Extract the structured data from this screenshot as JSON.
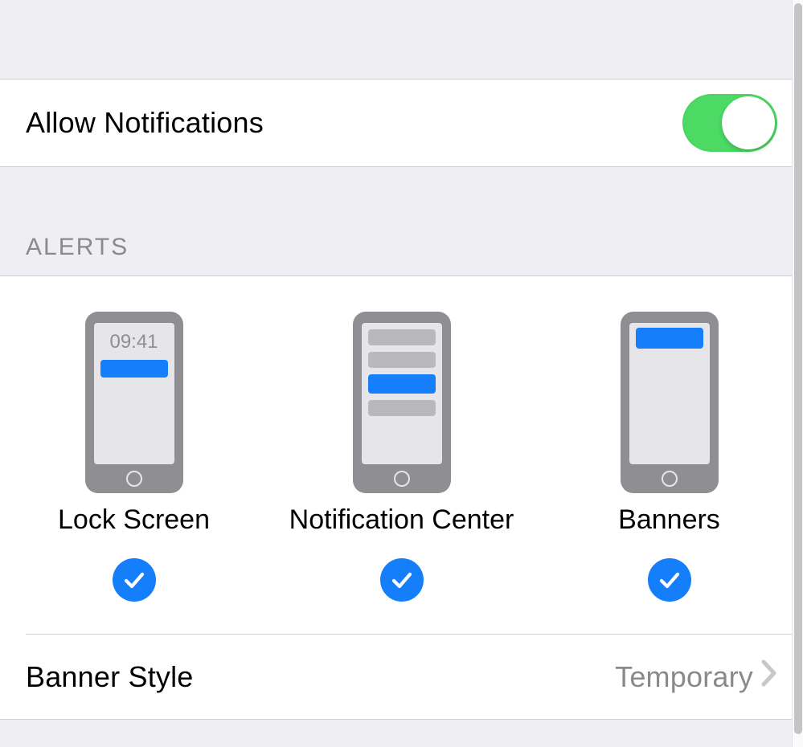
{
  "allow": {
    "label": "Allow Notifications",
    "value": true
  },
  "alerts": {
    "header": "ALERTS",
    "time_sample": "09:41",
    "options": [
      {
        "label": "Lock Screen",
        "checked": true
      },
      {
        "label": "Notification Center",
        "checked": true
      },
      {
        "label": "Banners",
        "checked": true
      }
    ]
  },
  "banner_style": {
    "label": "Banner Style",
    "value": "Temporary"
  },
  "colors": {
    "accent_blue": "#157efb",
    "toggle_green": "#4cd964",
    "bg_gray": "#efeff3"
  }
}
